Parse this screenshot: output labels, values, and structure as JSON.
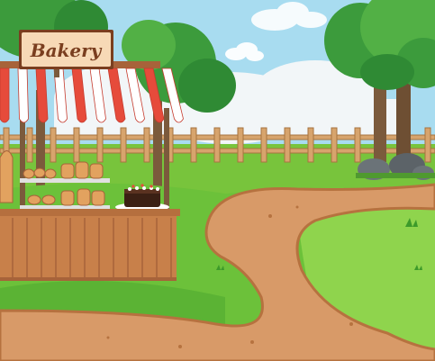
{
  "scene": {
    "sign_text": "Bakery",
    "colors": {
      "sky": "#a8dcf0",
      "grass": "#6cc13a",
      "grass_dark": "#3d9a2a",
      "path": "#d89a68",
      "path_edge": "#b6723f",
      "fence": "#d7a46d",
      "stall_wood": "#c8804a",
      "awning_red": "#e64b3b",
      "awning_white": "#ffffff",
      "sign_board": "#f7d9b6",
      "sign_text": "#7a3e1f",
      "tree_leaf": "#3c9b3c",
      "tree_trunk": "#7b5a3c",
      "rock": "#6b7378"
    }
  }
}
